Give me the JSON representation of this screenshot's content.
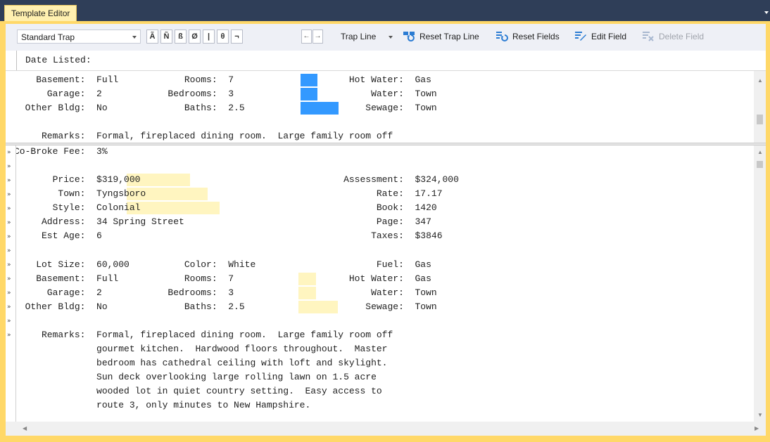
{
  "window": {
    "tab_title": "Template Editor"
  },
  "toolbar": {
    "template_select": "Standard Trap",
    "char_buttons": [
      "Ã",
      "Ñ",
      "ß",
      "Ø",
      "|",
      "θ",
      "¬"
    ],
    "trap_line_label": "Trap Line",
    "reset_trap_line_label": "Reset Trap Line",
    "reset_fields_label": "Reset Fields",
    "edit_field_label": "Edit Field",
    "delete_field_label": "Delete Field"
  },
  "field_bar": {
    "label": "Date Listed:"
  },
  "top_pane": {
    "lines": [
      "    Basement:  Full            Rooms:  7                     Hot Water:  Gas",
      "      Garage:  2            Bedrooms:  3                         Water:  Town",
      "  Other Bldg:  No              Baths:  2.5                      Sewage:  Town",
      "",
      "     Remarks:  Formal, fireplaced dining room.  Large family room off"
    ]
  },
  "bottom_pane": {
    "lines": [
      "Co-Broke Fee:  3%",
      "",
      "       Price:  $319,000                                     Assessment:  $324,000",
      "        Town:  Tyngsboro                                          Rate:  17.17",
      "       Style:  Colonial                                           Book:  1420",
      "     Address:  34 Spring Street                                   Page:  347",
      "     Est Age:  6                                                 Taxes:  $3846",
      "",
      "    Lot Size:  60,000          Color:  White                      Fuel:  Gas",
      "    Basement:  Full            Rooms:  7                     Hot Water:  Gas",
      "      Garage:  2            Bedrooms:  3                         Water:  Town",
      "  Other Bldg:  No              Baths:  2.5                      Sewage:  Town",
      "",
      "     Remarks:  Formal, fireplaced dining room.  Large family room off",
      "               gourmet kitchen.  Hardwood floors throughout.  Master",
      "               bedroom has cathedral ceiling with loft and skylight.",
      "               Sun deck overlooking large rolling lawn on 1.5 acre",
      "               wooded lot in quiet country setting.  Easy access to",
      "               route 3, only minutes to New Hampshire."
    ]
  },
  "colors": {
    "selection": "#3399ff",
    "field_highlight": "#fff5c0",
    "title_bar": "#2f3e58",
    "frame": "#ffd868"
  }
}
